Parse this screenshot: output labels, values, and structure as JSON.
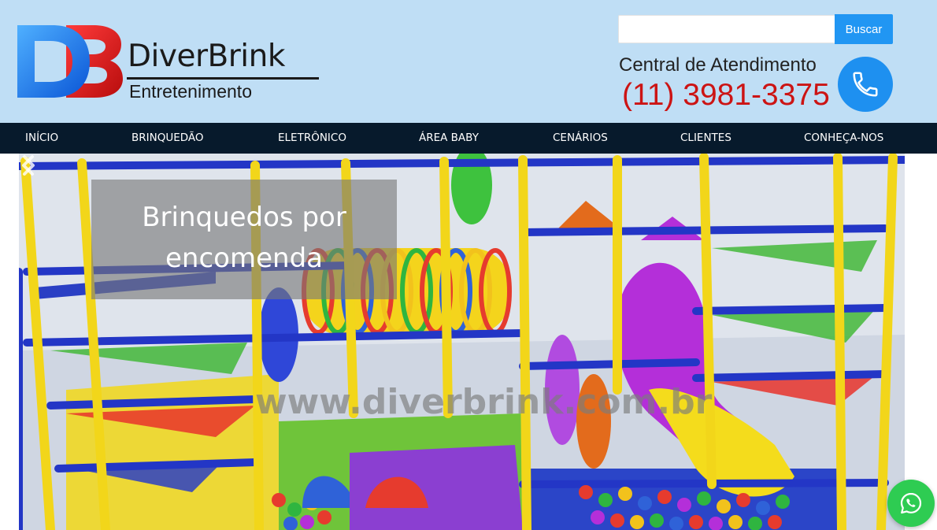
{
  "header": {
    "logo": {
      "monogram": "DB",
      "name": "DiverBrink",
      "tagline": "Entretenimento"
    },
    "search": {
      "value": "",
      "placeholder": "",
      "button_label": "Buscar"
    },
    "contact": {
      "label": "Central de Atendimento",
      "phone": "(11) 3981-3375",
      "icon": "phone-icon"
    }
  },
  "nav": {
    "items": [
      {
        "label": "INÍCIO"
      },
      {
        "label": "BRINQUEDÃO"
      },
      {
        "label": "ELETRÔNICO"
      },
      {
        "label": "ÁREA BABY"
      },
      {
        "label": "CENÁRIOS"
      },
      {
        "label": "CLIENTES"
      },
      {
        "label": "CONHEÇA-NOS"
      }
    ]
  },
  "hero": {
    "caption": "Brinquedos por\nencomenda",
    "watermark": "www.diverbrink.com.br",
    "prev_icon": "chevron-left-icon",
    "next_icon": "chevron-right-icon"
  },
  "whatsapp": {
    "icon": "whatsapp-icon"
  },
  "colors": {
    "header_bg": "#bfdef5",
    "nav_bg": "#071a2c",
    "accent_blue": "#2196f3",
    "phone_red": "#cc1414",
    "whatsapp_green": "#2ecc52"
  }
}
